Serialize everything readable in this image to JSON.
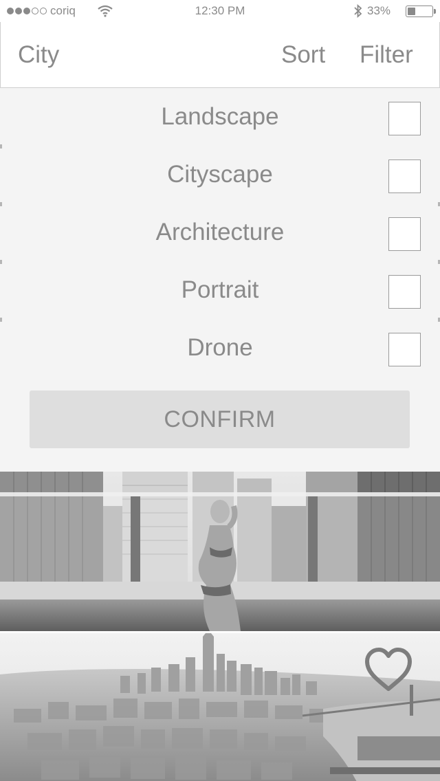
{
  "status_bar": {
    "carrier": "coriq",
    "time": "12:30 PM",
    "battery": "33%",
    "battery_level": 0.33,
    "signal_bars_filled": 3,
    "signal_bars_total": 5
  },
  "nav": {
    "title": "City",
    "sort_label": "Sort",
    "filter_label": "Filter"
  },
  "filters": [
    {
      "label": "Landscape",
      "checked": false
    },
    {
      "label": "Cityscape",
      "checked": false
    },
    {
      "label": "Architecture",
      "checked": false
    },
    {
      "label": "Portrait",
      "checked": false
    },
    {
      "label": "Drone",
      "checked": false
    }
  ],
  "confirm_label": "CONFIRM",
  "photos": [
    {
      "subject": "rooftop-pool-portrait",
      "favorite_icon": ""
    },
    {
      "subject": "aerial-city-skyline",
      "favorite_icon": "heart-icon"
    }
  ],
  "colors": {
    "text": "#8a8a8a",
    "panel": "#f4f4f4",
    "button": "#dedede"
  }
}
